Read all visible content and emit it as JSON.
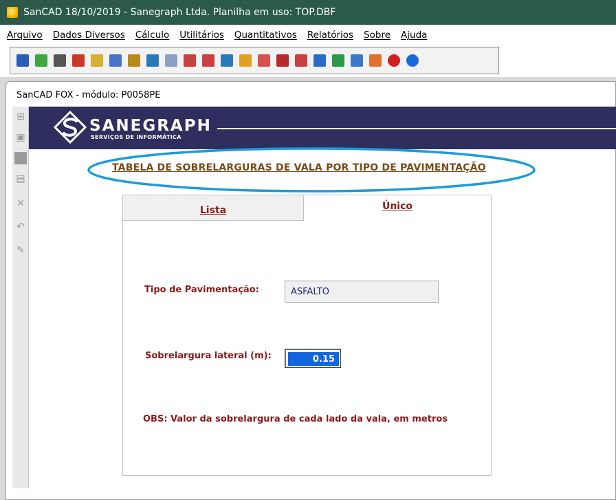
{
  "window": {
    "title": "SanCAD 18/10/2019 - Sanegraph Ltda. Planilha em uso: TOP.DBF",
    "icon": "sancad-app-icon"
  },
  "menu": [
    "Arquivo",
    "Dados Diversos",
    "Cálculo",
    "Utilitários",
    "Quantitativos",
    "Relatórios",
    "Sobre",
    "Ajuda"
  ],
  "toolbar": {
    "buttons": [
      {
        "icon": "exit-door-icon",
        "color": "#2a5fb8"
      },
      {
        "icon": "download-icon",
        "color": "#3ea83e"
      },
      {
        "icon": "import-icon",
        "color": "#555555"
      },
      {
        "icon": "bucket-icon",
        "color": "#c83a2a"
      },
      {
        "icon": "edit-sheet-icon",
        "color": "#d6b030"
      },
      {
        "icon": "search-icon",
        "color": "#4a74c8"
      },
      {
        "icon": "books-icon",
        "color": "#b88a18"
      },
      {
        "icon": "calculator-icon",
        "color": "#2a7ab8"
      },
      {
        "icon": "document-icon",
        "color": "#8aa0c8"
      },
      {
        "icon": "print-preview-icon",
        "color": "#c84040"
      },
      {
        "icon": "print-icon",
        "color": "#c84040"
      },
      {
        "icon": "edit-pencil-icon",
        "color": "#2a7ab8"
      },
      {
        "icon": "tools-icon",
        "color": "#e0a020"
      },
      {
        "icon": "line-chart-icon",
        "color": "#d85050"
      },
      {
        "icon": "grid-icon",
        "color": "#b82a2a"
      },
      {
        "icon": "export-red-icon",
        "color": "#c84040"
      },
      {
        "icon": "export-blue-icon",
        "color": "#2a6ac8"
      },
      {
        "icon": "export-green-icon",
        "color": "#2a9a4a"
      },
      {
        "icon": "window-icon",
        "color": "#3a7ac8"
      },
      {
        "icon": "users-icon",
        "color": "#e07030"
      },
      {
        "icon": "help-red-icon",
        "color": "#d02020"
      },
      {
        "icon": "help-blue-icon",
        "color": "#1a6ad8"
      }
    ]
  },
  "child_window": {
    "title": "SanCAD FOX - módulo: P0058PE"
  },
  "left_toolbar": [
    "add-record-icon",
    "save-icon",
    "blank-icon",
    "monitor-icon",
    "delete-icon",
    "undo-icon",
    "edit-icon"
  ],
  "banner": {
    "logo_name": "SANEGRAPH",
    "logo_sub": "SERVIÇOS DE INFORMÁTICA",
    "background": "#2e2f5e"
  },
  "heading": "TABELA DE SOBRELARGURAS DE VALA POR TIPO DE PAVIMENTAÇÃO",
  "tabs": [
    {
      "label": "Lista",
      "active": false
    },
    {
      "label": "Único",
      "active": true
    }
  ],
  "form": {
    "pavimentacao_label": "Tipo de Pavimentação:",
    "pavimentacao_value": "ASFALTO",
    "sobrelargura_label": "Sobrelargura lateral (m):",
    "sobrelargura_value": "0.15",
    "obs": "OBS: Valor da sobrelargura de cada lado da vala, em metros"
  },
  "colors": {
    "titlebar": "#2b5a4c",
    "label": "#8b1a1a",
    "heading": "#7a4a18",
    "highlight_ellipse": "#1f9bd8",
    "selection": "#1166dd"
  }
}
